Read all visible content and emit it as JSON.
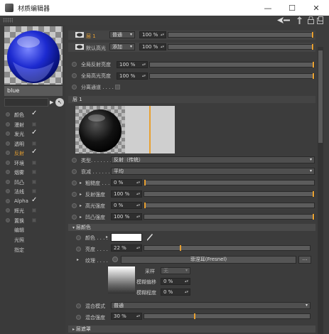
{
  "window": {
    "title": "材质编辑器",
    "minimize": "—",
    "maximize": "☐",
    "close": "✕"
  },
  "material": {
    "name": "blue"
  },
  "channels": [
    {
      "label": "颜色",
      "checked": true,
      "active": false
    },
    {
      "label": "漫射",
      "checked": false,
      "active": false
    },
    {
      "label": "发光",
      "checked": true,
      "active": false
    },
    {
      "label": "透明",
      "checked": false,
      "active": false
    },
    {
      "label": "反射",
      "checked": true,
      "active": true
    },
    {
      "label": "环境",
      "checked": false,
      "active": false
    },
    {
      "label": "烟雾",
      "checked": false,
      "active": false
    },
    {
      "label": "凹凸",
      "checked": false,
      "active": false
    },
    {
      "label": "法线",
      "checked": false,
      "active": false
    },
    {
      "label": "Alpha",
      "checked": true,
      "active": false
    },
    {
      "label": "辉光",
      "checked": false,
      "active": false
    },
    {
      "label": "置换",
      "checked": false,
      "active": false
    }
  ],
  "left_links": [
    "编辑",
    "光照",
    "指定"
  ],
  "layers": [
    {
      "name": "层 1",
      "blend": "普通",
      "value": "100 %"
    },
    {
      "name": "默认高光",
      "blend": "添加",
      "value": "100 %"
    }
  ],
  "global": {
    "reflect_label": "全局反射亮度",
    "reflect_value": "100 %",
    "spec_label": "全局高光亮度",
    "spec_value": "100 %",
    "separate_label": "分离通道 . . . . ."
  },
  "layer1": {
    "header": "层 1",
    "type_label": "类型. . . . . . .",
    "type_value": "反射（传统）",
    "atten_label": "衰减 . . . . . . .",
    "atten_value": "平均",
    "rough_label": "粗糙度 . . .",
    "rough_value": "0 %",
    "refl_label": "反射强度",
    "refl_value": "100 %",
    "spec_label": "高光强度",
    "spec_value": "0 %",
    "bump_label": "凹凸强度",
    "bump_value": "100 %"
  },
  "layer_color": {
    "header": "层颜色",
    "color_label": "颜色 . . . .",
    "bright_label": "亮度 . . . .",
    "bright_value": "22 %",
    "texture_label": "纹理 . . . .",
    "texture_value": "菲涅耳(Fresnel)",
    "sample_label": "采样",
    "sample_value": "无",
    "blur_offset_label": "模糊偏移",
    "blur_offset_value": "0 %",
    "blur_scale_label": "模糊程度",
    "blur_scale_value": "0 %",
    "mix_mode_label": "混合模式",
    "mix_mode_value": "普通",
    "mix_strength_label": "混合强度",
    "mix_strength_value": "30 %"
  },
  "layer_mask": {
    "header": "层遮罩"
  },
  "colors": {
    "accent": "#e8a030",
    "panel": "#3c3c3c"
  }
}
